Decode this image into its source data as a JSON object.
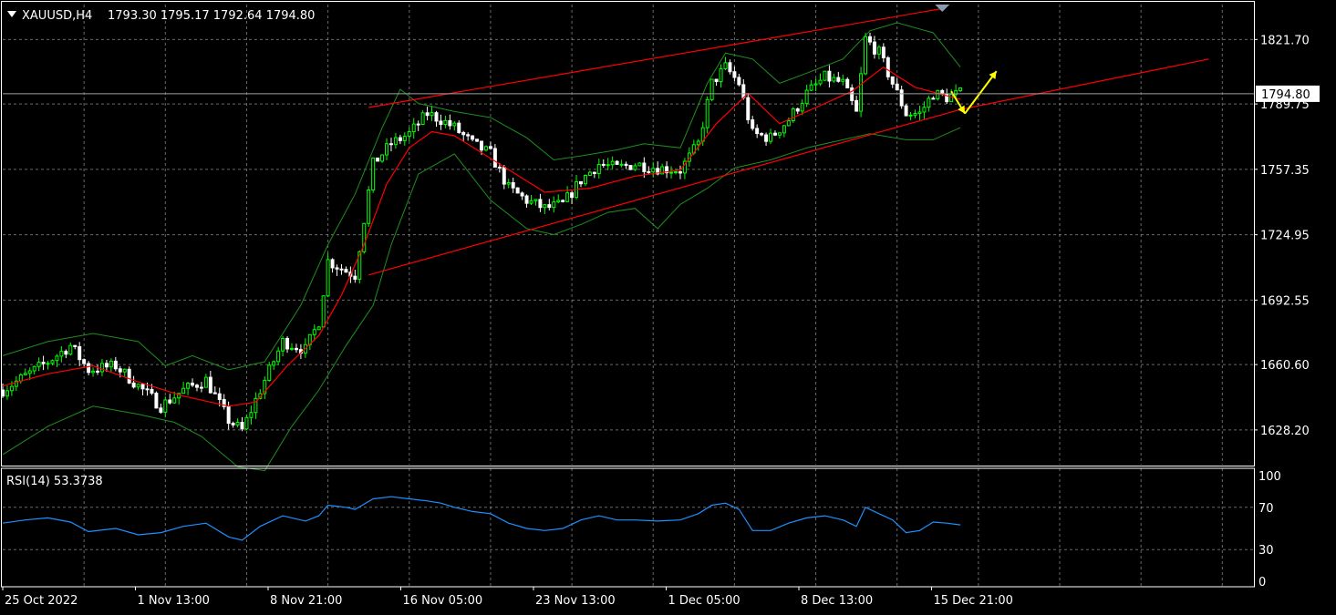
{
  "header": {
    "symbol": "XAUUSD,H4",
    "ohlc": "1793.30 1795.17 1792.64 1794.80",
    "dropdown_icon": "triangle-down-icon"
  },
  "current_price_label": "1794.80",
  "rsi": {
    "label": "RSI(14) 53.3738",
    "levels": [
      "100",
      "70",
      "30",
      "0"
    ]
  },
  "colors": {
    "background": "#000000",
    "grid": "#c0c0c0",
    "bull_candle": "#00ff00",
    "bear_candle": "#ffffff",
    "moving_average": "#ff0000",
    "bollinger_bands": "#1e8f1e",
    "channel_lines": "#ff0000",
    "rsi_line": "#1e90ff",
    "annotation_arrows": "#ffff00"
  },
  "chart_data": [
    {
      "type": "candlestick",
      "symbol": "XAUUSD",
      "timeframe": "H4",
      "ylim": [
        1611,
        1839
      ],
      "y_ticks": [
        "1821.70",
        "1789.75",
        "1757.35",
        "1724.95",
        "1692.55",
        "1660.60",
        "1628.20"
      ],
      "x_ticks": [
        "25 Oct 2022",
        "1 Nov 13:00",
        "8 Nov 21:00",
        "16 Nov 05:00",
        "23 Nov 13:00",
        "1 Dec 05:00",
        "8 Dec 13:00",
        "15 Dec 21:00"
      ],
      "grid": true,
      "close_path": [
        [
          0,
          1648
        ],
        [
          5,
          1655
        ],
        [
          10,
          1662
        ],
        [
          15,
          1670
        ],
        [
          19,
          1658
        ],
        [
          25,
          1660
        ],
        [
          30,
          1650
        ],
        [
          35,
          1640
        ],
        [
          40,
          1648
        ],
        [
          45,
          1653
        ],
        [
          50,
          1633
        ],
        [
          53,
          1628
        ],
        [
          57,
          1648
        ],
        [
          62,
          1672
        ],
        [
          67,
          1668
        ],
        [
          70,
          1682
        ],
        [
          72,
          1712
        ],
        [
          76,
          1707
        ],
        [
          78,
          1705
        ],
        [
          82,
          1760
        ],
        [
          86,
          1770
        ],
        [
          90,
          1775
        ],
        [
          94,
          1785
        ],
        [
          97,
          1782
        ],
        [
          100,
          1778
        ],
        [
          104,
          1770
        ],
        [
          108,
          1765
        ],
        [
          112,
          1748
        ],
        [
          116,
          1742
        ],
        [
          120,
          1738
        ],
        [
          124,
          1740
        ],
        [
          128,
          1752
        ],
        [
          132,
          1760
        ],
        [
          136,
          1758
        ],
        [
          140,
          1760
        ],
        [
          145,
          1758
        ],
        [
          150,
          1757
        ],
        [
          154,
          1770
        ],
        [
          157,
          1800
        ],
        [
          160,
          1808
        ],
        [
          163,
          1800
        ],
        [
          166,
          1775
        ],
        [
          170,
          1773
        ],
        [
          174,
          1782
        ],
        [
          178,
          1795
        ],
        [
          182,
          1803
        ],
        [
          186,
          1800
        ],
        [
          189,
          1785
        ],
        [
          191,
          1822
        ],
        [
          194,
          1815
        ],
        [
          197,
          1800
        ],
        [
          200,
          1785
        ],
        [
          203,
          1785
        ],
        [
          206,
          1795
        ],
        [
          209,
          1793
        ],
        [
          212,
          1795
        ]
      ],
      "moving_average": [
        [
          0,
          1650
        ],
        [
          10,
          1656
        ],
        [
          20,
          1660
        ],
        [
          30,
          1652
        ],
        [
          40,
          1645
        ],
        [
          50,
          1640
        ],
        [
          56,
          1642
        ],
        [
          63,
          1660
        ],
        [
          70,
          1675
        ],
        [
          75,
          1695
        ],
        [
          80,
          1720
        ],
        [
          85,
          1750
        ],
        [
          90,
          1768
        ],
        [
          95,
          1776
        ],
        [
          100,
          1774
        ],
        [
          110,
          1760
        ],
        [
          120,
          1746
        ],
        [
          130,
          1748
        ],
        [
          140,
          1754
        ],
        [
          150,
          1757
        ],
        [
          158,
          1780
        ],
        [
          165,
          1795
        ],
        [
          172,
          1780
        ],
        [
          180,
          1788
        ],
        [
          188,
          1796
        ],
        [
          195,
          1808
        ],
        [
          202,
          1798
        ],
        [
          212,
          1792
        ]
      ],
      "bollinger_upper": [
        [
          0,
          1665
        ],
        [
          10,
          1672
        ],
        [
          20,
          1676
        ],
        [
          30,
          1672
        ],
        [
          36,
          1660
        ],
        [
          42,
          1665
        ],
        [
          50,
          1658
        ],
        [
          58,
          1662
        ],
        [
          66,
          1690
        ],
        [
          72,
          1720
        ],
        [
          78,
          1745
        ],
        [
          84,
          1778
        ],
        [
          88,
          1797
        ],
        [
          92,
          1790
        ],
        [
          100,
          1786
        ],
        [
          108,
          1783
        ],
        [
          116,
          1773
        ],
        [
          122,
          1762
        ],
        [
          128,
          1764
        ],
        [
          136,
          1767
        ],
        [
          142,
          1770
        ],
        [
          150,
          1768
        ],
        [
          156,
          1800
        ],
        [
          160,
          1815
        ],
        [
          166,
          1812
        ],
        [
          172,
          1800
        ],
        [
          178,
          1805
        ],
        [
          186,
          1812
        ],
        [
          192,
          1826
        ],
        [
          198,
          1830
        ],
        [
          206,
          1825
        ],
        [
          212,
          1808
        ]
      ],
      "bollinger_lower": [
        [
          0,
          1616
        ],
        [
          10,
          1630
        ],
        [
          20,
          1640
        ],
        [
          30,
          1636
        ],
        [
          38,
          1632
        ],
        [
          44,
          1625
        ],
        [
          52,
          1610
        ],
        [
          58,
          1608
        ],
        [
          64,
          1630
        ],
        [
          70,
          1648
        ],
        [
          76,
          1670
        ],
        [
          82,
          1690
        ],
        [
          86,
          1720
        ],
        [
          92,
          1755
        ],
        [
          100,
          1765
        ],
        [
          108,
          1742
        ],
        [
          116,
          1728
        ],
        [
          122,
          1725
        ],
        [
          128,
          1730
        ],
        [
          134,
          1736
        ],
        [
          140,
          1738
        ],
        [
          145,
          1728
        ],
        [
          150,
          1740
        ],
        [
          156,
          1748
        ],
        [
          162,
          1758
        ],
        [
          170,
          1762
        ],
        [
          178,
          1768
        ],
        [
          186,
          1772
        ],
        [
          192,
          1775
        ],
        [
          200,
          1772
        ],
        [
          206,
          1772
        ],
        [
          212,
          1778
        ]
      ],
      "channel_upper": [
        [
          81,
          1788
        ],
        [
          208,
          1837
        ]
      ],
      "channel_lower": [
        [
          81,
          1705
        ],
        [
          212,
          1787
        ],
        [
          267,
          1812
        ]
      ],
      "arrows": [
        {
          "from": [
            210,
            1796
          ],
          "to": [
            213,
            1785
          ]
        },
        {
          "from": [
            213,
            1785
          ],
          "to": [
            220,
            1806
          ]
        }
      ]
    },
    {
      "type": "line",
      "name": "RSI(14)",
      "ylim": [
        0,
        100
      ],
      "y_ticks": [
        100,
        70,
        30,
        0
      ],
      "values": [
        [
          0,
          55
        ],
        [
          5,
          58
        ],
        [
          10,
          60
        ],
        [
          15,
          56
        ],
        [
          19,
          47
        ],
        [
          25,
          50
        ],
        [
          30,
          44
        ],
        [
          35,
          46
        ],
        [
          40,
          52
        ],
        [
          45,
          55
        ],
        [
          50,
          42
        ],
        [
          53,
          39
        ],
        [
          57,
          52
        ],
        [
          62,
          62
        ],
        [
          67,
          57
        ],
        [
          70,
          62
        ],
        [
          72,
          72
        ],
        [
          76,
          70
        ],
        [
          78,
          68
        ],
        [
          82,
          78
        ],
        [
          86,
          80
        ],
        [
          90,
          78
        ],
        [
          94,
          76
        ],
        [
          97,
          74
        ],
        [
          100,
          70
        ],
        [
          104,
          66
        ],
        [
          108,
          64
        ],
        [
          112,
          55
        ],
        [
          116,
          50
        ],
        [
          120,
          48
        ],
        [
          124,
          50
        ],
        [
          128,
          58
        ],
        [
          132,
          62
        ],
        [
          136,
          58
        ],
        [
          140,
          58
        ],
        [
          145,
          57
        ],
        [
          150,
          58
        ],
        [
          154,
          64
        ],
        [
          157,
          72
        ],
        [
          160,
          74
        ],
        [
          163,
          68
        ],
        [
          166,
          48
        ],
        [
          170,
          48
        ],
        [
          174,
          55
        ],
        [
          178,
          60
        ],
        [
          182,
          62
        ],
        [
          186,
          58
        ],
        [
          189,
          52
        ],
        [
          191,
          70
        ],
        [
          194,
          64
        ],
        [
          197,
          58
        ],
        [
          200,
          46
        ],
        [
          203,
          48
        ],
        [
          206,
          56
        ],
        [
          209,
          55
        ],
        [
          212,
          53.3738
        ]
      ]
    }
  ]
}
